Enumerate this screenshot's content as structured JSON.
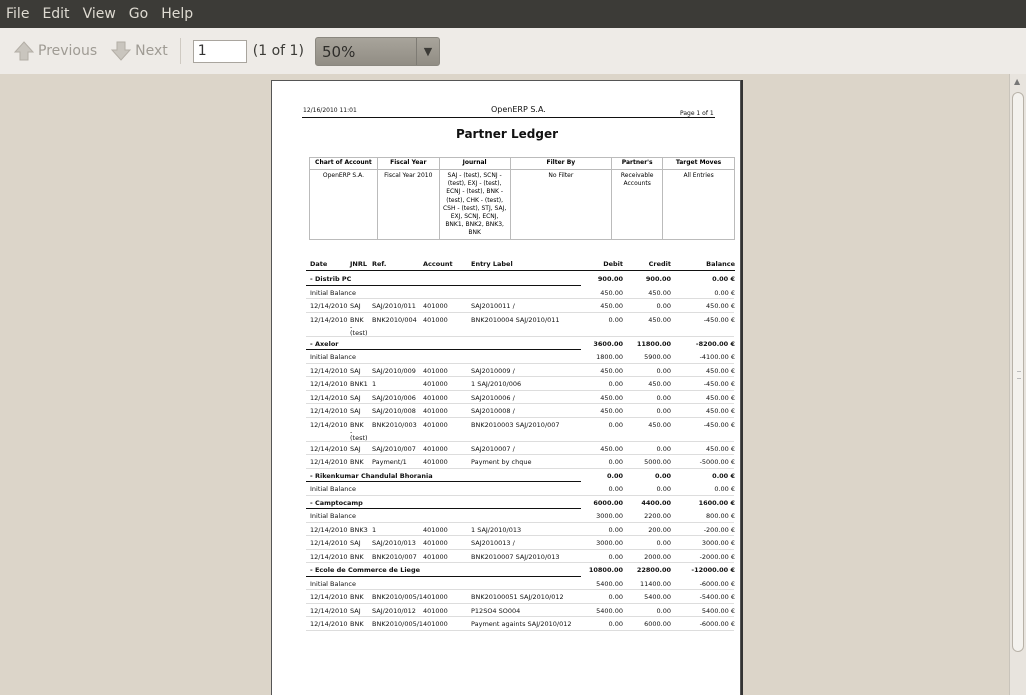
{
  "menu": [
    "File",
    "Edit",
    "View",
    "Go",
    "Help"
  ],
  "toolbar": {
    "previous": "Previous",
    "next": "Next",
    "page_value": "1",
    "page_of": "(1 of 1)",
    "zoom": "50%"
  },
  "doc": {
    "date": "12/16/2010  11:01",
    "company": "OpenERP S.A.",
    "page": "Page 1 of 1",
    "title": "Partner Ledger",
    "filters": {
      "headers": [
        "Chart of Account",
        "Fiscal Year",
        "Journal",
        "Filter By",
        "Partner's",
        "Target Moves"
      ],
      "values": [
        "OpenERP S.A.",
        "Fiscal Year 2010",
        "SAJ - (test), SCNJ - (test), EXJ - (test), ECNJ - (test), BNK - (test), CHK - (test), CSH - (test), STJ, SAJ, EXJ, SCNJ, ECNJ, BNK1, BNK2, BNK3, BNK",
        "No Filter",
        "Receivable Accounts",
        "All Entries"
      ]
    },
    "columns": [
      "Date",
      "JNRL",
      "Ref.",
      "Account",
      "Entry Label",
      "Debit",
      "Credit",
      "Balance"
    ],
    "rows": [
      {
        "t": "partner",
        "date": "- Distrib PC",
        "debit": "900.00",
        "credit": "900.00",
        "balance": "0.00 €"
      },
      {
        "t": "init",
        "date": "Initial Balance",
        "debit": "450.00",
        "credit": "450.00",
        "balance": "0.00 €"
      },
      {
        "t": "line",
        "date": "12/14/2010",
        "jnrl": "SAJ",
        "ref": "SAJ/2010/011",
        "acc": "401000",
        "label": "SAJ2010011 /",
        "debit": "450.00",
        "credit": "0.00",
        "balance": "450.00 €"
      },
      {
        "t": "line",
        "date": "12/14/2010",
        "jnrl": "BNK",
        "ref": "BNK2010/004",
        "acc": "401000",
        "label": "BNK2010004 SAJ/2010/011",
        "debit": "0.00",
        "credit": "450.00",
        "balance": "-450.00 €",
        "x1": "-",
        "x2": "(test)"
      },
      {
        "t": "partner",
        "date": "- Axelor",
        "debit": "3600.00",
        "credit": "11800.00",
        "balance": "-8200.00 €"
      },
      {
        "t": "init",
        "date": "Initial Balance",
        "debit": "1800.00",
        "credit": "5900.00",
        "balance": "-4100.00 €"
      },
      {
        "t": "line",
        "date": "12/14/2010",
        "jnrl": "SAJ",
        "ref": "SAJ/2010/009",
        "acc": "401000",
        "label": "SAJ2010009 /",
        "debit": "450.00",
        "credit": "0.00",
        "balance": "450.00 €"
      },
      {
        "t": "line",
        "date": "12/14/2010",
        "jnrl": "BNK1",
        "ref": "1",
        "acc": "401000",
        "label": "1 SAJ/2010/006",
        "debit": "0.00",
        "credit": "450.00",
        "balance": "-450.00 €"
      },
      {
        "t": "line",
        "date": "12/14/2010",
        "jnrl": "SAJ",
        "ref": "SAJ/2010/006",
        "acc": "401000",
        "label": "SAJ2010006 /",
        "debit": "450.00",
        "credit": "0.00",
        "balance": "450.00 €"
      },
      {
        "t": "line",
        "date": "12/14/2010",
        "jnrl": "SAJ",
        "ref": "SAJ/2010/008",
        "acc": "401000",
        "label": "SAJ2010008 /",
        "debit": "450.00",
        "credit": "0.00",
        "balance": "450.00 €"
      },
      {
        "t": "line",
        "date": "12/14/2010",
        "jnrl": "BNK",
        "ref": "BNK2010/003",
        "acc": "401000",
        "label": "BNK2010003 SAJ/2010/007",
        "debit": "0.00",
        "credit": "450.00",
        "balance": "-450.00 €",
        "x1": "-",
        "x2": "(test)"
      },
      {
        "t": "line",
        "date": "12/14/2010",
        "jnrl": "SAJ",
        "ref": "SAJ/2010/007",
        "acc": "401000",
        "label": "SAJ2010007 /",
        "debit": "450.00",
        "credit": "0.00",
        "balance": "450.00 €"
      },
      {
        "t": "line",
        "date": "12/14/2010",
        "jnrl": "BNK",
        "ref": "Payment/1",
        "acc": "401000",
        "label": "Payment by chque",
        "debit": "0.00",
        "credit": "5000.00",
        "balance": "-5000.00 €"
      },
      {
        "t": "partner",
        "date": "- Rikenkumar Chandulal Bhorania",
        "debit": "0.00",
        "credit": "0.00",
        "balance": "0.00 €"
      },
      {
        "t": "init",
        "date": "Initial Balance",
        "debit": "0.00",
        "credit": "0.00",
        "balance": "0.00 €"
      },
      {
        "t": "partner",
        "date": "- Camptocamp",
        "debit": "6000.00",
        "credit": "4400.00",
        "balance": "1600.00 €"
      },
      {
        "t": "init",
        "date": "Initial Balance",
        "debit": "3000.00",
        "credit": "2200.00",
        "balance": "800.00 €"
      },
      {
        "t": "line",
        "date": "12/14/2010",
        "jnrl": "BNK3",
        "ref": "1",
        "acc": "401000",
        "label": "1 SAJ/2010/013",
        "debit": "0.00",
        "credit": "200.00",
        "balance": "-200.00 €"
      },
      {
        "t": "line",
        "date": "12/14/2010",
        "jnrl": "SAJ",
        "ref": "SAJ/2010/013",
        "acc": "401000",
        "label": "SAJ2010013 /",
        "debit": "3000.00",
        "credit": "0.00",
        "balance": "3000.00 €"
      },
      {
        "t": "line",
        "date": "12/14/2010",
        "jnrl": "BNK",
        "ref": "BNK2010/007",
        "acc": "401000",
        "label": "BNK2010007 SAJ/2010/013",
        "debit": "0.00",
        "credit": "2000.00",
        "balance": "-2000.00 €"
      },
      {
        "t": "partner",
        "date": "- Ecole de Commerce de Liege",
        "debit": "10800.00",
        "credit": "22800.00",
        "balance": "-12000.00 €"
      },
      {
        "t": "init",
        "date": "Initial Balance",
        "debit": "5400.00",
        "credit": "11400.00",
        "balance": "-6000.00 €"
      },
      {
        "t": "line",
        "date": "12/14/2010",
        "jnrl": "BNK",
        "ref": "BNK2010/005/1",
        "acc": "401000",
        "label": "BNK20100051 SAJ/2010/012",
        "debit": "0.00",
        "credit": "5400.00",
        "balance": "-5400.00 €"
      },
      {
        "t": "line",
        "date": "12/14/2010",
        "jnrl": "SAJ",
        "ref": "SAJ/2010/012",
        "acc": "401000",
        "label": "P12SO4 SO004",
        "debit": "5400.00",
        "credit": "0.00",
        "balance": "5400.00 €"
      },
      {
        "t": "line",
        "date": "12/14/2010",
        "jnrl": "BNK",
        "ref": "BNK2010/005/1",
        "acc": "401000",
        "label": "Payment againts SAJ/2010/012",
        "debit": "0.00",
        "credit": "6000.00",
        "balance": "-6000.00 €"
      }
    ]
  }
}
